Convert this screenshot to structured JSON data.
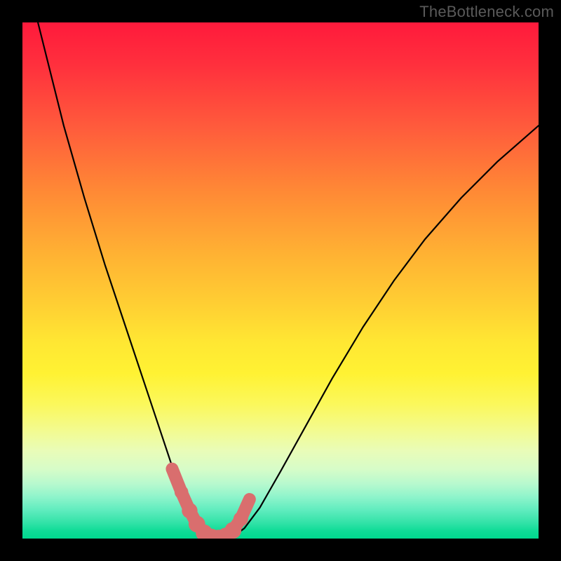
{
  "watermark": "TheBottleneck.com",
  "colors": {
    "frame": "#000000",
    "curve": "#000000",
    "marker_fill": "#d96e6e",
    "marker_stroke": "#c95b5b"
  },
  "chart_data": {
    "type": "line",
    "title": "",
    "xlabel": "",
    "ylabel": "",
    "xlim": [
      0,
      100
    ],
    "ylim": [
      0,
      100
    ],
    "grid": false,
    "legend": false,
    "series": [
      {
        "name": "bottleneck-curve",
        "description": "V-shaped bottleneck curve; y≈0 at the minimum, rising toward 100 at the extremes",
        "x": [
          3,
          5,
          8,
          12,
          16,
          20,
          24,
          27,
          29,
          31,
          33,
          35,
          37,
          39,
          41,
          43,
          46,
          50,
          55,
          60,
          66,
          72,
          78,
          85,
          92,
          100
        ],
        "y": [
          100,
          92,
          80,
          66,
          53,
          41,
          29,
          20,
          14,
          9,
          5,
          2,
          0.5,
          0,
          0.5,
          2,
          6,
          13,
          22,
          31,
          41,
          50,
          58,
          66,
          73,
          80
        ]
      }
    ],
    "markers": {
      "name": "highlight-dots",
      "description": "Salmon dots/segment tracing the bottom of the valley",
      "x_range": [
        29,
        43
      ],
      "points": [
        {
          "x": 29.0,
          "y": 13.5,
          "r": 1.1
        },
        {
          "x": 30.8,
          "y": 9.0,
          "r": 1.4
        },
        {
          "x": 32.4,
          "y": 5.4,
          "r": 1.6
        },
        {
          "x": 33.8,
          "y": 2.8,
          "r": 1.7
        },
        {
          "x": 35.2,
          "y": 1.1,
          "r": 1.7
        },
        {
          "x": 36.6,
          "y": 0.3,
          "r": 1.7
        },
        {
          "x": 38.0,
          "y": 0.1,
          "r": 1.7
        },
        {
          "x": 39.4,
          "y": 0.5,
          "r": 1.7
        },
        {
          "x": 40.8,
          "y": 1.6,
          "r": 1.7
        },
        {
          "x": 42.3,
          "y": 3.8,
          "r": 1.5
        },
        {
          "x": 44.0,
          "y": 7.6,
          "r": 1.1
        }
      ]
    }
  }
}
